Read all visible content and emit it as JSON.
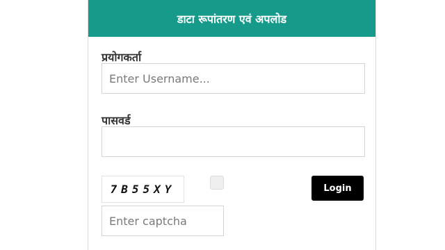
{
  "header": {
    "title": "डाटा रूपांतरण एवं अपलोड"
  },
  "form": {
    "username_label": "प्रयोगकर्ता",
    "username_placeholder": "Enter Username...",
    "username_value": "",
    "password_label": "पासवर्ड",
    "password_value": "",
    "captcha_text": "7B55XY",
    "captcha_placeholder": "Enter captcha",
    "login_label": "Login"
  },
  "colors": {
    "header_bg": "#169b8b",
    "login_bg": "#000000"
  }
}
